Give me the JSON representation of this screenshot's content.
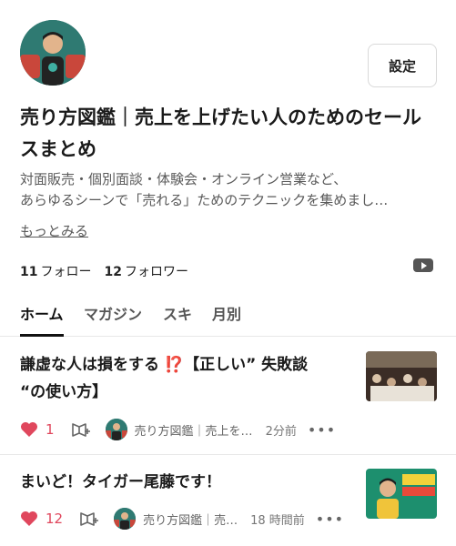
{
  "profile": {
    "title": "売り方図鑑｜売上を上げたい人のためのセールスまとめ",
    "desc_lines": [
      "対面販売・個別面談・体験会・オンライン営業など、",
      "あらゆるシーンで「売れる」ためのテクニックを集めまし…"
    ],
    "more": "もっとみる",
    "settings": "設定"
  },
  "stats": {
    "follow_count": "11",
    "follow_label": "フォロー",
    "follower_count": "12",
    "follower_label": "フォロワー"
  },
  "tabs": [
    "ホーム",
    "マガジン",
    "スキ",
    "月別"
  ],
  "articles": [
    {
      "title": "謙虚な人は損をする ⁉️【正しい” 失敗談 “の使い方】",
      "likes": "1",
      "author": "売り方図鑑｜売上を…",
      "time": "2分前"
    },
    {
      "title": "まいど！タイガー尾藤です！",
      "likes": "12",
      "author": "売り方図鑑｜売…",
      "time": "18 時間前"
    }
  ],
  "colors": {
    "like": "#e0475d",
    "text": "#222222",
    "muted": "#666666"
  },
  "icons": [
    "heart-icon",
    "magazine-add-icon",
    "youtube-icon",
    "more-dots-icon"
  ]
}
